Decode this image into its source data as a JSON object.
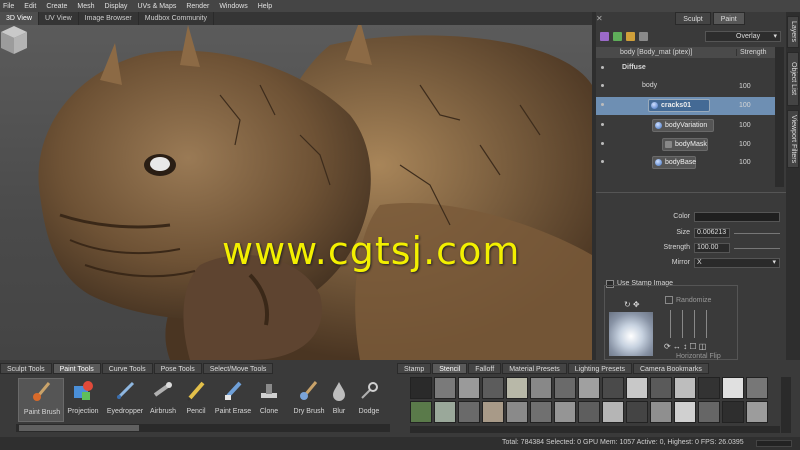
{
  "menu": [
    "File",
    "Edit",
    "Create",
    "Mesh",
    "Display",
    "UVs & Maps",
    "Render",
    "Windows",
    "Help"
  ],
  "viewport_tabs": [
    "3D View",
    "UV View",
    "Image Browser",
    "Mudbox Community"
  ],
  "watermark": "www.cgtsj.com",
  "right_tabs": {
    "sculpt": "Sculpt",
    "paint": "Paint"
  },
  "blend_mode": "Overlay",
  "layers_header": {
    "name": "body [Body_mat (ptex)]",
    "strength": "Strength"
  },
  "layers": [
    {
      "label": "Diffuse",
      "value": ""
    },
    {
      "label": "body",
      "value": "100"
    },
    {
      "label": "cracks01",
      "value": "100"
    },
    {
      "label": "bodyVariation",
      "value": "100"
    },
    {
      "label": "bodyMask",
      "value": "100"
    },
    {
      "label": "bodyBase",
      "value": "100"
    }
  ],
  "side_tabs": [
    "Layers",
    "Object List",
    "Viewport Filters"
  ],
  "properties": {
    "color_label": "Color",
    "size_label": "Size",
    "size_value": "0.006213",
    "strength_label": "Strength",
    "strength_value": "100.00",
    "mirror_label": "Mirror",
    "mirror_value": "X"
  },
  "stamp": {
    "use_stamp": "Use Stamp Image",
    "randomize": "Randomize",
    "horizontal_flip": "Horizontal Flip"
  },
  "tool_tabs": [
    "Sculpt Tools",
    "Paint Tools",
    "Curve Tools",
    "Pose Tools",
    "Select/Move Tools"
  ],
  "tools": [
    "Paint Brush",
    "Projection",
    "Eyedropper",
    "Airbrush",
    "Pencil",
    "Paint Erase",
    "Clone",
    "Dry Brush",
    "Blur",
    "Dodge"
  ],
  "stamp_tabs": [
    "Stamp",
    "Stencil",
    "Falloff",
    "Material Presets",
    "Lighting Presets",
    "Camera Bookmarks"
  ],
  "status": "Total: 784384  Selected: 0 GPU Mem: 1057  Active: 0, Highest: 0  FPS: 26.0395",
  "colors": {
    "accent": "#6e8fb3",
    "watermark": "#f3f000"
  }
}
